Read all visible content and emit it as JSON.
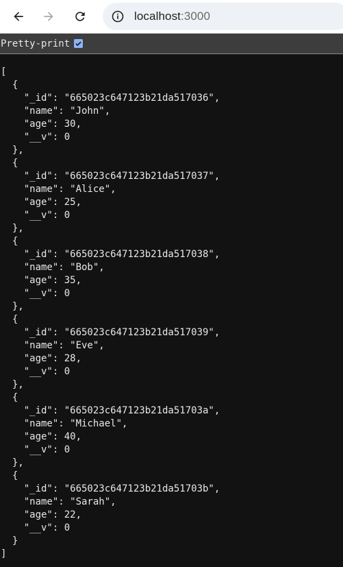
{
  "browser": {
    "url_host": "localhost",
    "url_port": ":3000"
  },
  "pretty_print": {
    "label": "Pretty-print",
    "checked": true
  },
  "records": [
    {
      "_id": "665023c647123b21da517036",
      "name": "John",
      "age": 30,
      "__v": 0
    },
    {
      "_id": "665023c647123b21da517037",
      "name": "Alice",
      "age": 25,
      "__v": 0
    },
    {
      "_id": "665023c647123b21da517038",
      "name": "Bob",
      "age": 35,
      "__v": 0
    },
    {
      "_id": "665023c647123b21da517039",
      "name": "Eve",
      "age": 28,
      "__v": 0
    },
    {
      "_id": "665023c647123b21da51703a",
      "name": "Michael",
      "age": 40,
      "__v": 0
    },
    {
      "_id": "665023c647123b21da51703b",
      "name": "Sarah",
      "age": 22,
      "__v": 0
    }
  ]
}
